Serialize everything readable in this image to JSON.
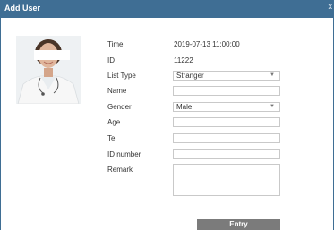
{
  "dialog": {
    "title": "Add User",
    "close_label": "x"
  },
  "photo": {
    "icon": "user-photo-with-privacy-bar"
  },
  "fields": {
    "time": {
      "label": "Time",
      "value": "2019-07-13 11:00:00"
    },
    "id": {
      "label": "ID",
      "value": "11222"
    },
    "list_type": {
      "label": "List Type",
      "value": "Stranger"
    },
    "name": {
      "label": "Name",
      "value": ""
    },
    "gender": {
      "label": "Gender",
      "value": "Male"
    },
    "age": {
      "label": "Age",
      "value": ""
    },
    "tel": {
      "label": "Tel",
      "value": ""
    },
    "id_number": {
      "label": "ID number",
      "value": ""
    },
    "remark": {
      "label": "Remark",
      "value": ""
    }
  },
  "actions": {
    "entry_label": "Entry"
  },
  "colors": {
    "title_bar": "#3f6e94",
    "button": "#7b7b7b",
    "input_border": "#c9c9c9"
  }
}
